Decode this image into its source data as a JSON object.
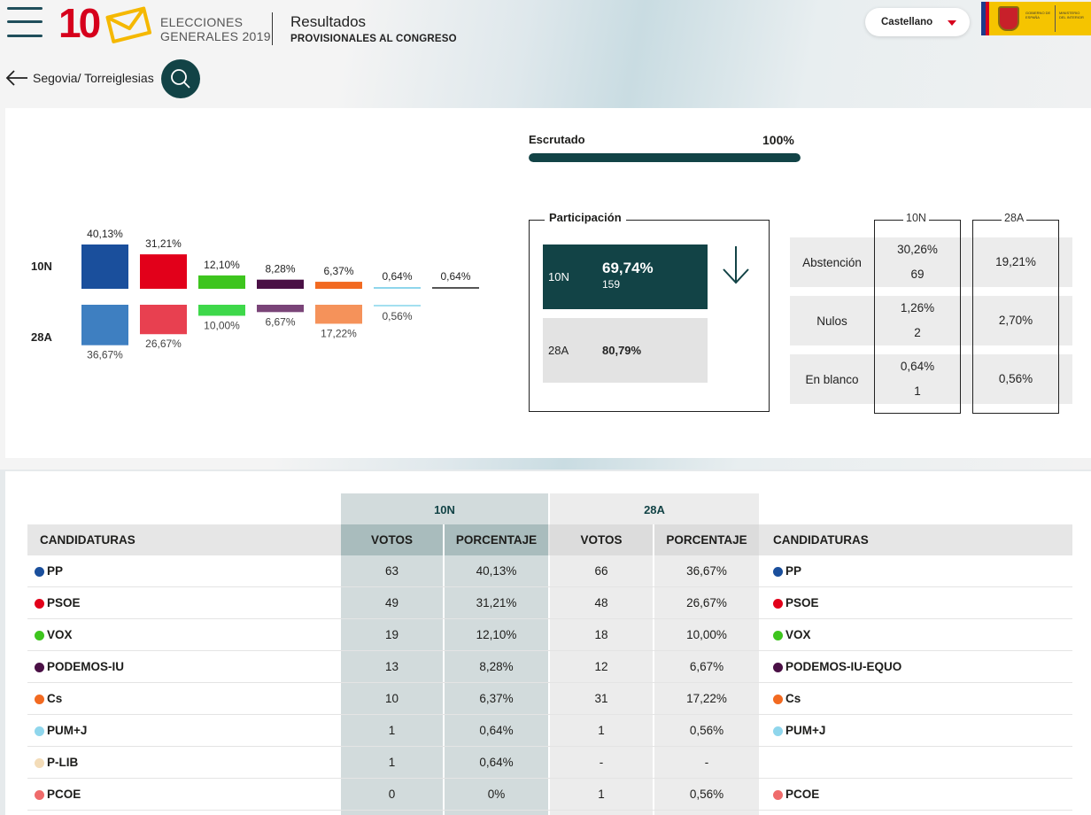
{
  "header": {
    "logo_number": "10",
    "logo_text_line1": "ELECCIONES",
    "logo_text_line2": "GENERALES 2019",
    "title": "Resultados",
    "subtitle": "PROVISIONALES AL CONGRESO",
    "language": "Castellano",
    "gov_text_1": "GOBIERNO DE ESPAÑA",
    "gov_text_2": "MINISTERIO DEL INTERIOR"
  },
  "breadcrumb": {
    "location": "Segovia/ Torreiglesias"
  },
  "escrutado": {
    "label": "Escrutado",
    "value": "100%",
    "fraction": 1.0
  },
  "chart_data": {
    "type": "bar",
    "row_labels": [
      "10N",
      "28A"
    ],
    "series": [
      {
        "name": "10N",
        "values": [
          40.13,
          31.21,
          12.1,
          8.28,
          6.37,
          0.64,
          0.64
        ],
        "labels": [
          "40,13%",
          "31,21%",
          "12,10%",
          "8,28%",
          "6,37%",
          "0,64%",
          "0,64%"
        ]
      },
      {
        "name": "28A",
        "values": [
          36.67,
          26.67,
          10.0,
          6.67,
          17.22,
          0.56
        ],
        "labels": [
          "36,67%",
          "26,67%",
          "10,00%",
          "6,67%",
          "17,22%",
          "0,56%"
        ]
      }
    ],
    "colors_10n": [
      "#1a4f9c",
      "#e2001a",
      "#3ec51e",
      "#4a1045",
      "#f26a21",
      "#8fd6ec",
      "#555555"
    ],
    "colors_28a": [
      "#3e7fc1",
      "#e84050",
      "#3ed84a",
      "#7a4478",
      "#f5925a",
      "#a4e0f0"
    ]
  },
  "participacion": {
    "title": "Participación",
    "rows": [
      {
        "label": "10N",
        "pct": "69,74%",
        "count": "159"
      },
      {
        "label": "28A",
        "pct": "80,79%",
        "count": ""
      }
    ]
  },
  "stats": {
    "col_10n": "10N",
    "col_28a": "28A",
    "rows": [
      {
        "label": "Abstención",
        "v10n_pct": "30,26%",
        "v10n_count": "69",
        "v28a_pct": "19,21%"
      },
      {
        "label": "Nulos",
        "v10n_pct": "1,26%",
        "v10n_count": "2",
        "v28a_pct": "2,70%"
      },
      {
        "label": "En blanco",
        "v10n_pct": "0,64%",
        "v10n_count": "1",
        "v28a_pct": "0,56%"
      }
    ]
  },
  "table": {
    "group_10n": "10N",
    "group_28a": "28A",
    "h_candidaturas": "CANDIDATURAS",
    "h_votos": "VOTOS",
    "h_porcentaje": "PORCENTAJE",
    "rows": [
      {
        "party": "PP",
        "color": "#1a4f9c",
        "v10n": "63",
        "p10n": "40,13%",
        "v28a": "66",
        "p28a": "36,67%",
        "party28a": "PP",
        "color28a": "#1a4f9c"
      },
      {
        "party": "PSOE",
        "color": "#e2001a",
        "v10n": "49",
        "p10n": "31,21%",
        "v28a": "48",
        "p28a": "26,67%",
        "party28a": "PSOE",
        "color28a": "#e2001a"
      },
      {
        "party": "VOX",
        "color": "#3ec51e",
        "v10n": "19",
        "p10n": "12,10%",
        "v28a": "18",
        "p28a": "10,00%",
        "party28a": "VOX",
        "color28a": "#3ec51e"
      },
      {
        "party": "PODEMOS-IU",
        "color": "#4a1045",
        "v10n": "13",
        "p10n": "8,28%",
        "v28a": "12",
        "p28a": "6,67%",
        "party28a": "PODEMOS-IU-EQUO",
        "color28a": "#4a1045"
      },
      {
        "party": "Cs",
        "color": "#f26a21",
        "v10n": "10",
        "p10n": "6,37%",
        "v28a": "31",
        "p28a": "17,22%",
        "party28a": "Cs",
        "color28a": "#f26a21"
      },
      {
        "party": "PUM+J",
        "color": "#8fd6ec",
        "v10n": "1",
        "p10n": "0,64%",
        "v28a": "1",
        "p28a": "0,56%",
        "party28a": "PUM+J",
        "color28a": "#8fd6ec"
      },
      {
        "party": "P-LIB",
        "color": "#f3dcb8",
        "v10n": "1",
        "p10n": "0,64%",
        "v28a": "-",
        "p28a": "-",
        "party28a": "",
        "color28a": ""
      },
      {
        "party": "PCOE",
        "color": "#ef6b6b",
        "v10n": "0",
        "p10n": "0%",
        "v28a": "1",
        "p28a": "0,56%",
        "party28a": "PCOE",
        "color28a": "#ef6b6b"
      }
    ]
  }
}
